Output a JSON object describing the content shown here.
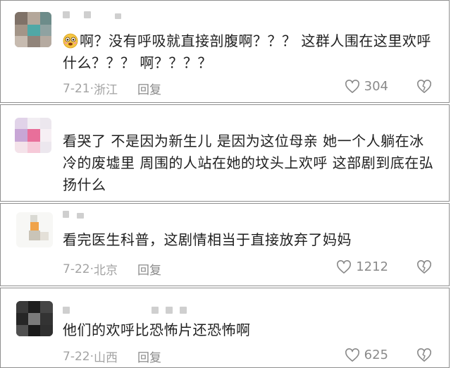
{
  "comments": [
    {
      "text": "啊？没有呼吸就直接剖腹啊？？？ 这群人围在这里欢呼什么？？？ 啊？？？？",
      "date": "7-21",
      "location": "浙江",
      "reply_label": "回复",
      "likes": "304",
      "has_emoji": true
    },
    {
      "text": "看哭了 不是因为新生儿 是因为这位母亲 她一个人躺在冰冷的废墟里 周围的人站在她的坟头上欢呼 这部剧到底在弘扬什么"
    },
    {
      "text": "看完医生科普，这剧情相当于直接放弃了妈妈",
      "date": "7-22",
      "location": "北京",
      "reply_label": "回复",
      "likes": "1212"
    },
    {
      "text": "他们的欢呼比恐怖片还恐怖啊",
      "date": "7-22",
      "location": "山西",
      "reply_label": "回复",
      "likes": "625"
    }
  ],
  "meta_separator": "·",
  "colors": {
    "text": "#1f1f1f",
    "meta": "#a3a3a3",
    "border": "#8f8f8f",
    "mask": "#cfcfcf"
  },
  "icons": [
    "heart-icon",
    "broken-heart-icon",
    "flushed-face-emoji"
  ]
}
